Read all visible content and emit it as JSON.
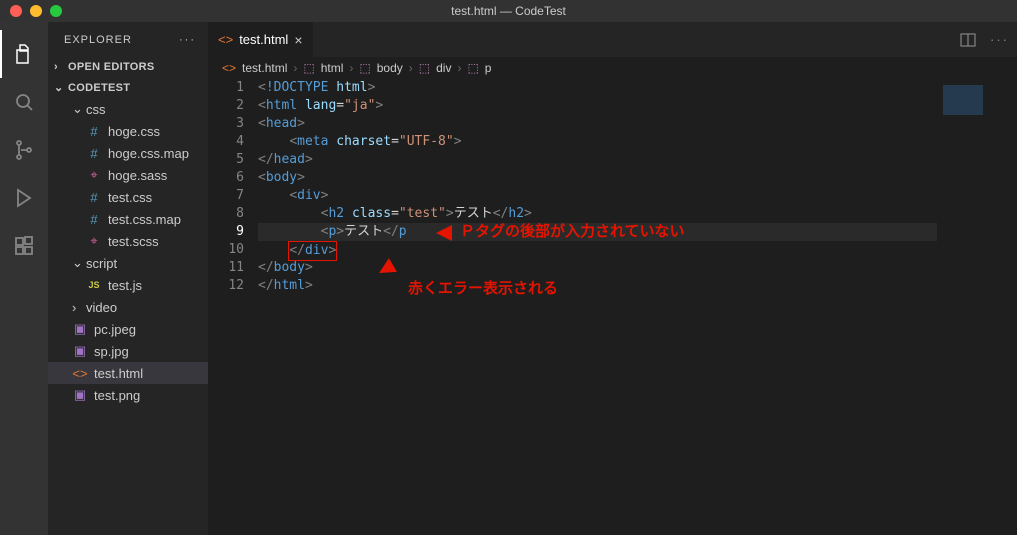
{
  "window": {
    "title": "test.html — CodeTest"
  },
  "explorer": {
    "label": "EXPLORER"
  },
  "sections": {
    "open_editors": "OPEN EDITORS",
    "project": "CODETEST"
  },
  "tree": {
    "css": {
      "name": "css",
      "files": [
        "hoge.css",
        "hoge.css.map",
        "hoge.sass",
        "test.css",
        "test.css.map",
        "test.scss"
      ]
    },
    "script": {
      "name": "script",
      "files": [
        "test.js"
      ]
    },
    "video": {
      "name": "video"
    },
    "root_files": [
      "pc.jpeg",
      "sp.jpg",
      "test.html",
      "test.png"
    ],
    "selected": "test.html"
  },
  "tab": {
    "name": "test.html"
  },
  "breadcrumbs": [
    "test.html",
    "html",
    "body",
    "div",
    "p"
  ],
  "code_lines": {
    "l1": {
      "n": "1"
    },
    "l2": {
      "n": "2"
    },
    "l3": {
      "n": "3"
    },
    "l4": {
      "n": "4"
    },
    "l5": {
      "n": "5"
    },
    "l6": {
      "n": "6"
    },
    "l7": {
      "n": "7"
    },
    "l8": {
      "n": "8"
    },
    "l9": {
      "n": "9"
    },
    "l10": {
      "n": "10"
    },
    "l11": {
      "n": "11"
    },
    "l12": {
      "n": "12"
    }
  },
  "tokens": {
    "doctype": "!DOCTYPE",
    "html": "html",
    "lang": "lang",
    "ja": "\"ja\"",
    "head": "head",
    "meta": "meta",
    "charset": "charset",
    "utf8": "\"UTF-8\"",
    "body": "body",
    "div": "div",
    "h2": "h2",
    "class": "class",
    "test": "\"test\"",
    "testtxt": "テスト",
    "p": "p"
  },
  "annotations": {
    "a1": "Ｐタグの後部が入力されていない",
    "a2": "赤くエラー表示される"
  }
}
